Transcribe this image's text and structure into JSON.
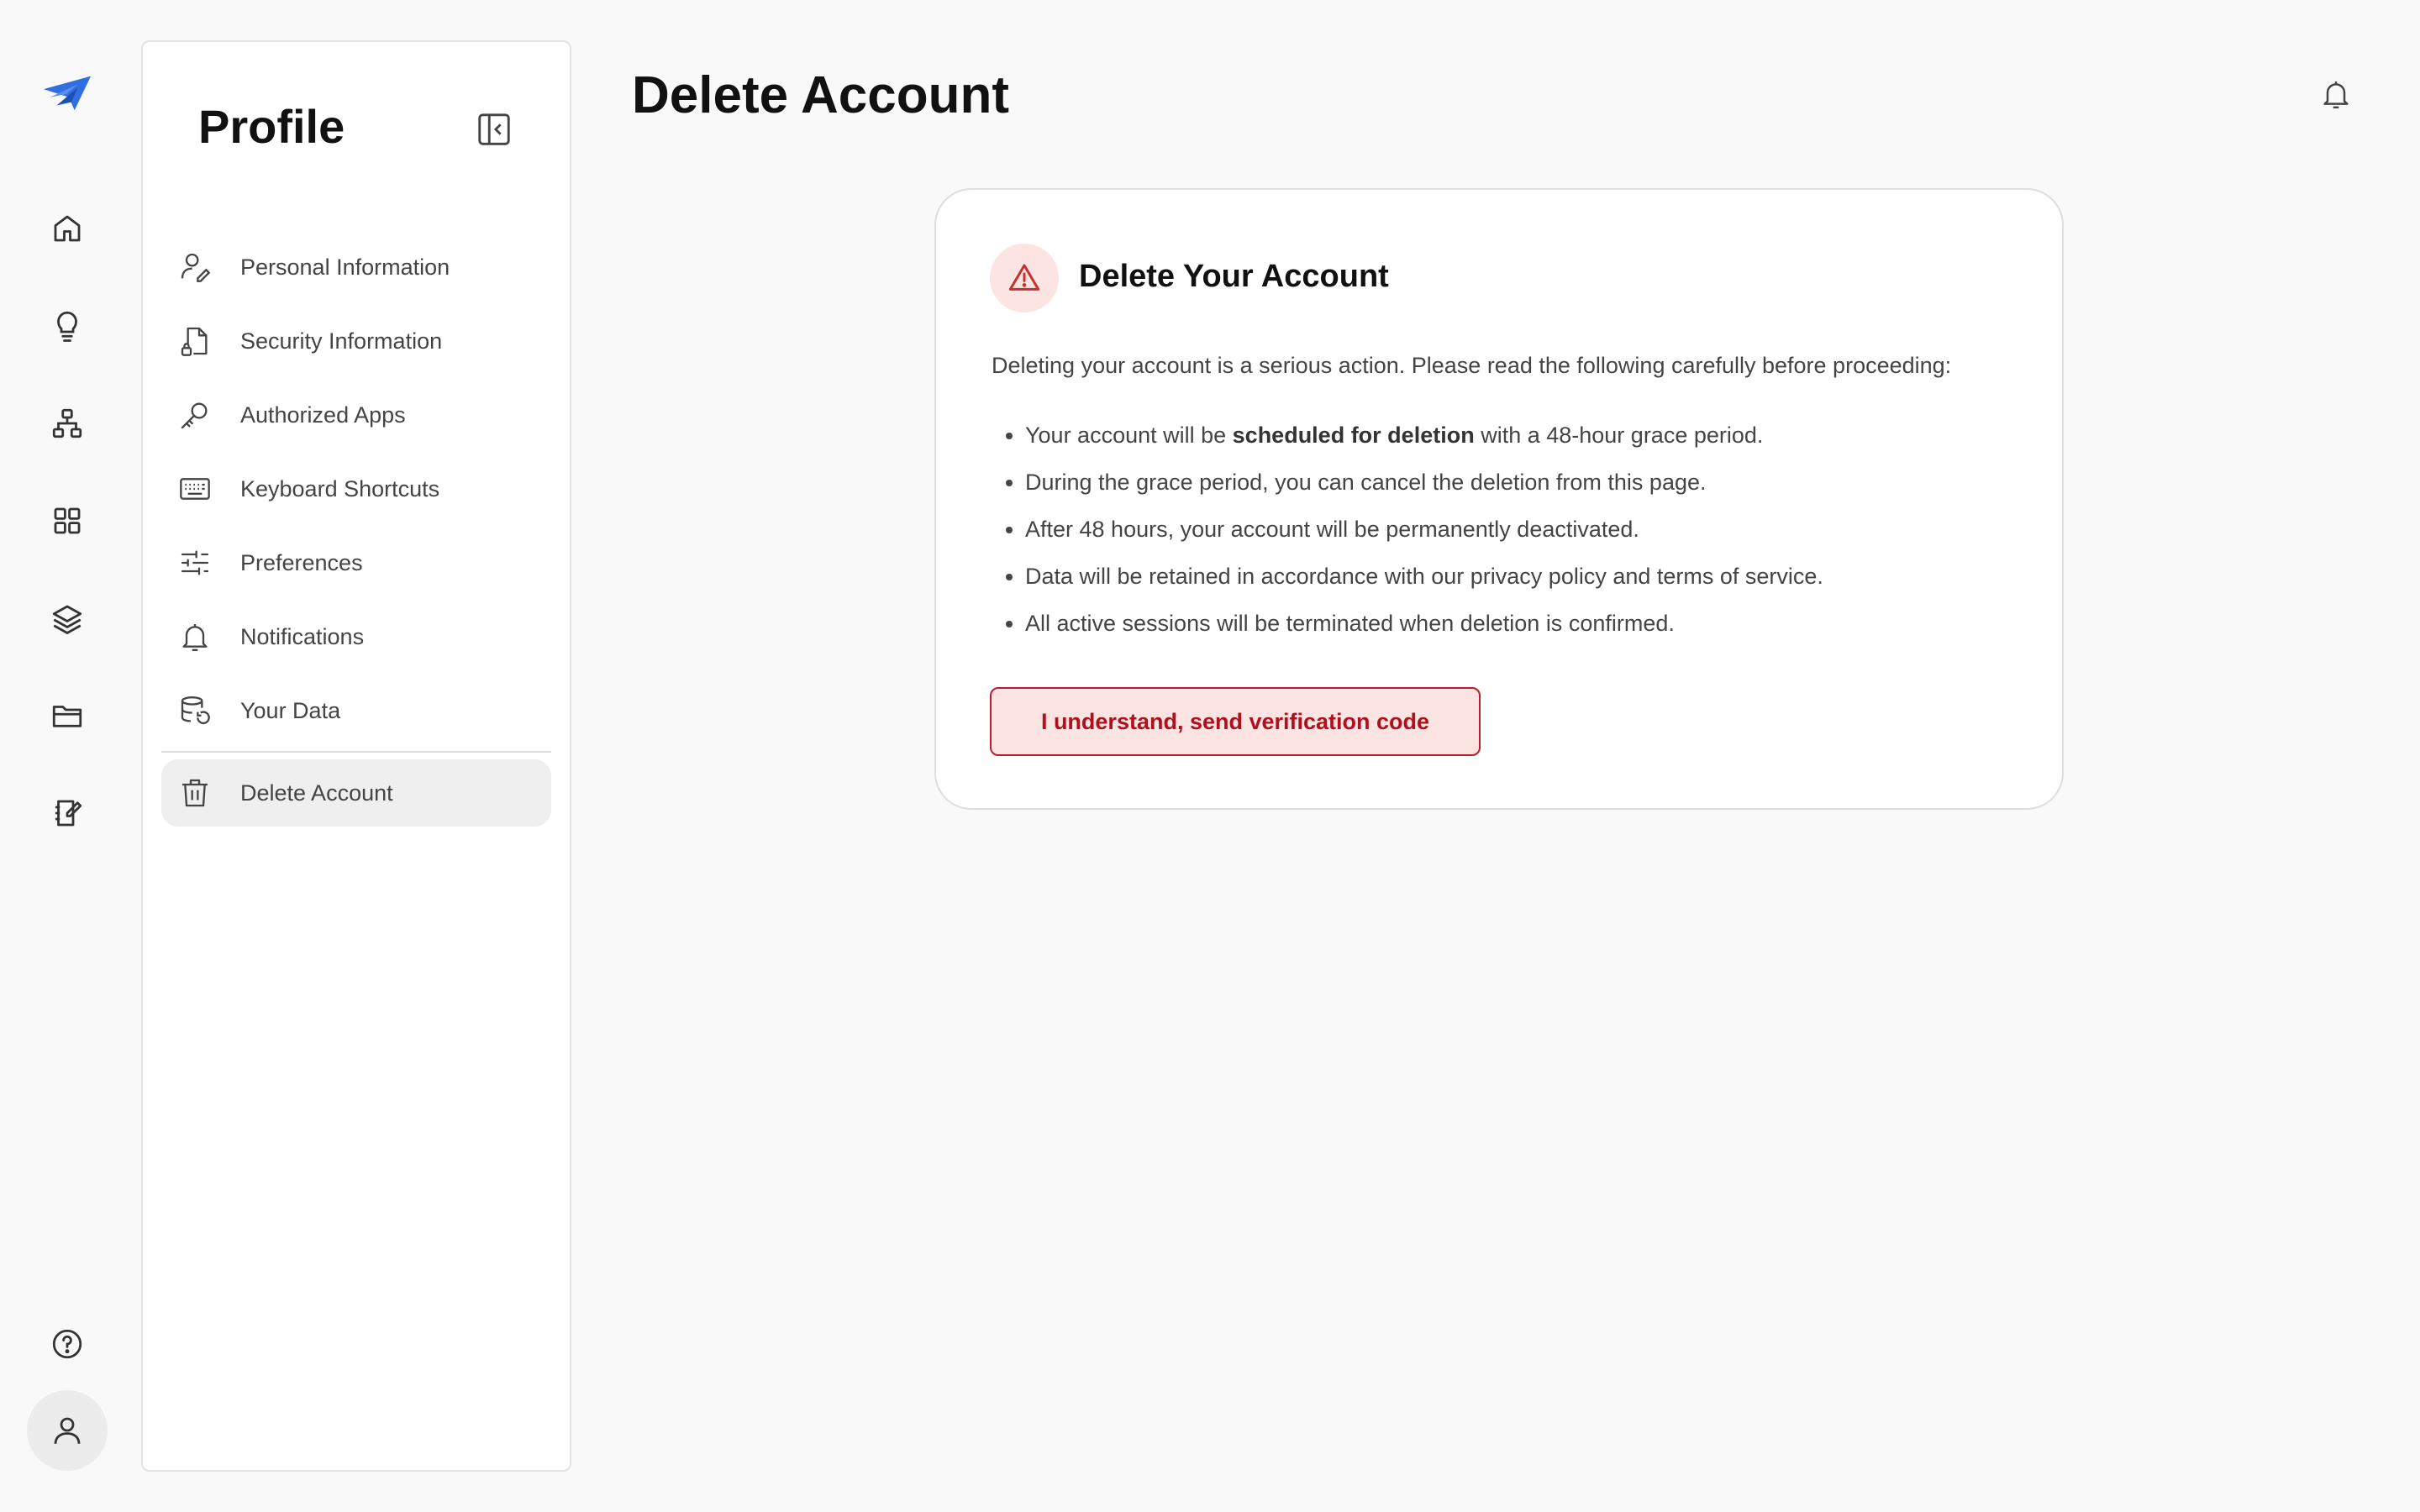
{
  "app": {
    "accent_color": "#2f6fe0",
    "danger_color": "#b91c2a",
    "danger_bg": "#fbe4e1"
  },
  "rail": {
    "icons": [
      "logo-icon",
      "home-icon",
      "lightbulb-icon",
      "hierarchy-icon",
      "grid-icon",
      "layers-icon",
      "folder-icon",
      "notebook-edit-icon",
      "help-icon",
      "user-icon"
    ]
  },
  "sidebar": {
    "title": "Profile",
    "items": [
      {
        "label": "Personal Information",
        "icon": "user-edit-icon"
      },
      {
        "label": "Security Information",
        "icon": "file-lock-icon"
      },
      {
        "label": "Authorized Apps",
        "icon": "key-icon"
      },
      {
        "label": "Keyboard Shortcuts",
        "icon": "keyboard-icon"
      },
      {
        "label": "Preferences",
        "icon": "sliders-icon"
      },
      {
        "label": "Notifications",
        "icon": "bell-icon"
      },
      {
        "label": "Your Data",
        "icon": "database-refresh-icon"
      },
      {
        "label": "Delete Account",
        "icon": "trash-icon",
        "active": true
      }
    ]
  },
  "header": {
    "title": "Delete Account"
  },
  "card": {
    "title": "Delete Your Account",
    "intro": "Deleting your account is a serious action. Please read the following carefully before proceeding:",
    "bullets": {
      "b1_pre": "Your account will be ",
      "b1_bold": "scheduled for deletion",
      "b1_post": " with a 48-hour grace period.",
      "b2": "During the grace period, you can cancel the deletion from this page.",
      "b3": "After 48 hours, your account will be permanently deactivated.",
      "b4": "Data will be retained in accordance with our privacy policy and terms of service.",
      "b5": "All active sessions will be terminated when deletion is confirmed."
    },
    "confirm_label": "I understand, send verification code"
  }
}
